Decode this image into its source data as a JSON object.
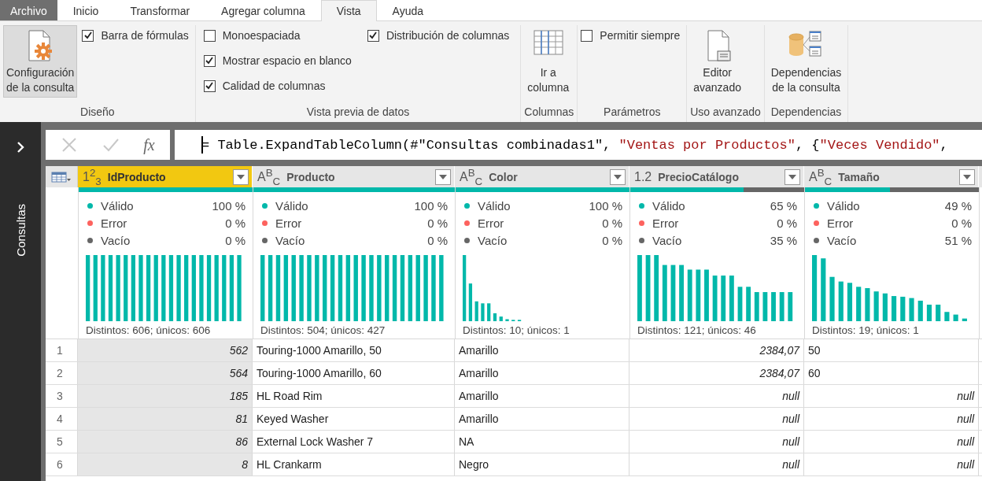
{
  "tabs": [
    {
      "label": "Archivo",
      "kind": "file",
      "selected": false
    },
    {
      "label": "Inicio",
      "kind": "tab",
      "selected": false
    },
    {
      "label": "Transformar",
      "kind": "tab",
      "selected": false
    },
    {
      "label": "Agregar columna",
      "kind": "tab",
      "selected": false
    },
    {
      "label": "Vista",
      "kind": "tab",
      "selected": true
    },
    {
      "label": "Ayuda",
      "kind": "tab",
      "selected": false
    }
  ],
  "ribbon": {
    "groups": [
      {
        "label": "Diseño",
        "items": [
          {
            "kind": "big-button",
            "lines": [
              "Configuración",
              "de la consulta"
            ],
            "pressed": true
          },
          {
            "kind": "checkbox",
            "label": "Barra de fórmulas",
            "checked": true
          }
        ]
      },
      {
        "label": "Vista previa de datos",
        "items": [
          {
            "kind": "checkbox",
            "label": "Monoespaciada",
            "checked": false
          },
          {
            "kind": "checkbox",
            "label": "Mostrar espacio en blanco",
            "checked": true
          },
          {
            "kind": "checkbox",
            "label": "Calidad de columnas",
            "checked": true
          },
          {
            "kind": "checkbox",
            "label": "Distribución de columnas",
            "checked": true
          }
        ]
      },
      {
        "label": "Columnas",
        "items": [
          {
            "kind": "big-button",
            "lines": [
              "Ir a",
              "columna"
            ],
            "pressed": false
          }
        ]
      },
      {
        "label": "Parámetros",
        "items": [
          {
            "kind": "checkbox",
            "label": "Permitir siempre",
            "checked": false
          }
        ]
      },
      {
        "label": "Uso avanzado",
        "items": [
          {
            "kind": "big-button",
            "lines": [
              "Editor",
              "avanzado"
            ],
            "pressed": false
          }
        ]
      },
      {
        "label": "Dependencias",
        "items": [
          {
            "kind": "big-button",
            "lines": [
              "Dependencias",
              "de la consulta"
            ],
            "pressed": false
          }
        ]
      }
    ]
  },
  "sidebar": {
    "title": "Consultas"
  },
  "formula_bar": {
    "fx": "fx",
    "segments": [
      {
        "kind": "code",
        "text": "= Table.ExpandTableColumn(#\"Consultas combinadas1\", "
      },
      {
        "kind": "string",
        "text": "\"Ventas por Productos\""
      },
      {
        "kind": "code",
        "text": ", {"
      },
      {
        "kind": "string",
        "text": "\"Veces Vendido\""
      },
      {
        "kind": "code",
        "text": ","
      }
    ]
  },
  "table": {
    "columns": [
      {
        "name": "IdProducto",
        "type": "1$^{2}$$_{3}$",
        "selected": true,
        "level": 1,
        "stats": [
          {
            "label": "Válido",
            "value": "100 %",
            "color": "#01b8aa"
          },
          {
            "label": "Error",
            "value": "0 %",
            "color": "#fd625e"
          },
          {
            "label": "Vacío",
            "value": "0 %",
            "color": "#666666"
          }
        ],
        "summary": "Distintos: 606; únicos: 606"
      },
      {
        "name": "Producto",
        "type": "A$^{B}$$_{C}$",
        "selected": false,
        "level": 1,
        "stats": [
          {
            "label": "Válido",
            "value": "100 %",
            "color": "#01b8aa"
          },
          {
            "label": "Error",
            "value": "0 %",
            "color": "#fd625e"
          },
          {
            "label": "Vacío",
            "value": "0 %",
            "color": "#666666"
          }
        ],
        "summary": "Distintos: 504; únicos: 427"
      },
      {
        "name": "Color",
        "type": "A$^{B}$$_{C}$",
        "selected": false,
        "level": 1,
        "stats": [
          {
            "label": "Válido",
            "value": "100 %",
            "color": "#01b8aa"
          },
          {
            "label": "Error",
            "value": "0 %",
            "color": "#fd625e"
          },
          {
            "label": "Vacío",
            "value": "0 %",
            "color": "#666666"
          }
        ],
        "summary": "Distintos: 10; únicos: 1"
      },
      {
        "name": "PrecioCatálogo",
        "type": "1.2",
        "selected": false,
        "level": 0.65,
        "stats": [
          {
            "label": "Válido",
            "value": "65 %",
            "color": "#01b8aa"
          },
          {
            "label": "Error",
            "value": "0 %",
            "color": "#fd625e"
          },
          {
            "label": "Vacío",
            "value": "35 %",
            "color": "#666666"
          }
        ],
        "summary": "Distintos: 121; únicos: 46"
      },
      {
        "name": "Tamaño",
        "type": "A$^{B}$$_{C}$",
        "selected": false,
        "level": 0.49,
        "stats": [
          {
            "label": "Válido",
            "value": "49 %",
            "color": "#01b8aa"
          },
          {
            "label": "Error",
            "value": "0 %",
            "color": "#fd625e"
          },
          {
            "label": "Vacío",
            "value": "51 %",
            "color": "#666666"
          }
        ],
        "summary": "Distintos: 19; únicos: 1"
      }
    ],
    "rows": [
      {
        "number": "1",
        "cells": [
          {
            "kind": "number",
            "text": "562"
          },
          {
            "kind": "text",
            "text": "Touring-1000 Amarillo, 50"
          },
          {
            "kind": "text",
            "text": "Amarillo"
          },
          {
            "kind": "number",
            "text": "2384,07"
          },
          {
            "kind": "text",
            "text": "50"
          }
        ]
      },
      {
        "number": "2",
        "cells": [
          {
            "kind": "number",
            "text": "564"
          },
          {
            "kind": "text",
            "text": "Touring-1000 Amarillo, 60"
          },
          {
            "kind": "text",
            "text": "Amarillo"
          },
          {
            "kind": "number",
            "text": "2384,07"
          },
          {
            "kind": "text",
            "text": "60"
          }
        ]
      },
      {
        "number": "3",
        "cells": [
          {
            "kind": "number",
            "text": "185"
          },
          {
            "kind": "text",
            "text": "HL Road Rim"
          },
          {
            "kind": "text",
            "text": "Amarillo"
          },
          {
            "kind": "null",
            "text": "null"
          },
          {
            "kind": "null",
            "text": "null"
          }
        ]
      },
      {
        "number": "4",
        "cells": [
          {
            "kind": "number",
            "text": "81"
          },
          {
            "kind": "text",
            "text": "Keyed Washer"
          },
          {
            "kind": "text",
            "text": "Amarillo"
          },
          {
            "kind": "null",
            "text": "null"
          },
          {
            "kind": "null",
            "text": "null"
          }
        ]
      },
      {
        "number": "5",
        "cells": [
          {
            "kind": "number",
            "text": "86"
          },
          {
            "kind": "text",
            "text": "External Lock Washer 7"
          },
          {
            "kind": "text",
            "text": "NA"
          },
          {
            "kind": "null",
            "text": "null"
          },
          {
            "kind": "null",
            "text": "null"
          }
        ]
      },
      {
        "number": "6",
        "cells": [
          {
            "kind": "number",
            "text": "8"
          },
          {
            "kind": "text",
            "text": "HL Crankarm"
          },
          {
            "kind": "text",
            "text": "Negro"
          },
          {
            "kind": "null",
            "text": "null"
          },
          {
            "kind": "null",
            "text": "null"
          }
        ]
      }
    ]
  }
}
